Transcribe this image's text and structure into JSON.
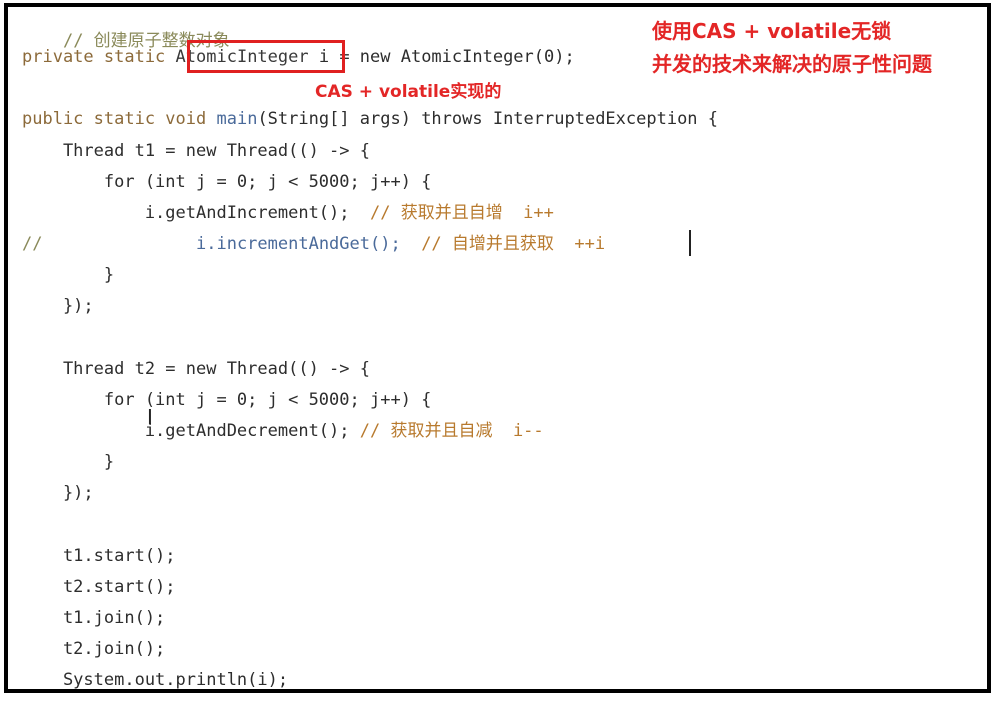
{
  "code": {
    "l1_comment": "// 创建原子整数对象",
    "l2_kw": "private static",
    "l2_type": "AtomicInteger",
    "l2_rest": " i = new AtomicInteger(0);",
    "l3_kw": "public static void",
    "l3_fn": "main",
    "l3_rest": "(String[] args) throws InterruptedException {",
    "l4": "    Thread t1 = new Thread(() -> {",
    "l5": "        for (int j = 0; j < 5000; j++) {",
    "l6_code": "            i.getAndIncrement();  ",
    "l6_comment": "// 获取并且自增  i++",
    "l7_prefix": "//",
    "l7_code": "               i.incrementAndGet();  ",
    "l7_comment": "// 自增并且获取  ++i",
    "l8": "        }",
    "l9": "    });",
    "l10": "    Thread t2 = new Thread(() -> {",
    "l11": "        for (int j = 0; j < 5000; j++) {",
    "l12_code": "            i.getAndDecrement(); ",
    "l12_comment": "// 获取并且自减  i--",
    "l13": "        }",
    "l14": "    });",
    "l15": "    t1.start();",
    "l16": "    t2.start();",
    "l17": "    t1.join();",
    "l18": "    t2.join();",
    "l19": "    System.out.println(i);"
  },
  "annotations": {
    "box_label": "CAS + volatile实现的",
    "top_right_line1": "使用CAS + volatile无锁",
    "top_right_line2": "并发的技术来解决的原子性问题"
  },
  "colors": {
    "annotation_red": "#e32626",
    "highlight_box": "#e02020",
    "comment": "#8a8a5a",
    "keyword": "#8c6a3a"
  },
  "icons": {
    "text_cursor": "i-beam-cursor-icon"
  }
}
